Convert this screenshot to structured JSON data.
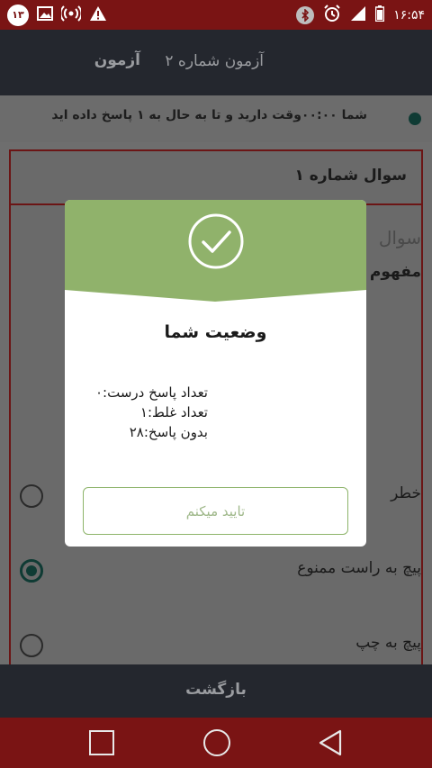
{
  "status_bar": {
    "notification_count": "۱۳",
    "time": "۱۶:۵۴",
    "icons_left": [
      "image-icon",
      "wifi-hotspot-icon",
      "warning-icon"
    ],
    "icons_right": [
      "bluetooth-icon",
      "alarm-icon",
      "signal-icon",
      "battery-icon"
    ]
  },
  "header": {
    "title": "آزمون",
    "subtitle": "آزمون شماره ۲"
  },
  "info_bar": {
    "text": "شما ۰۰:۰۰وقت دارید و تا به حال به ۱ پاسخ داده اید"
  },
  "question": {
    "header": "سوال شماره ۱",
    "title": "سوال",
    "text": "مفهوم",
    "options": [
      {
        "label": "خطر",
        "checked": false
      },
      {
        "label": "پیچ به راست ممنوع",
        "checked": true
      },
      {
        "label": "پیچ به چپ",
        "checked": false
      }
    ]
  },
  "back_bar": {
    "label": "بازگشت"
  },
  "modal": {
    "title": "وضعیت شما",
    "stats": [
      "تعداد پاسخ درست:۰",
      "تعداد غلط:۱",
      "بدون پاسخ:۲۸"
    ],
    "confirm_label": "تایید میکنم",
    "colors": {
      "header_green": "#90b26b",
      "button_border": "#8db46a"
    }
  }
}
